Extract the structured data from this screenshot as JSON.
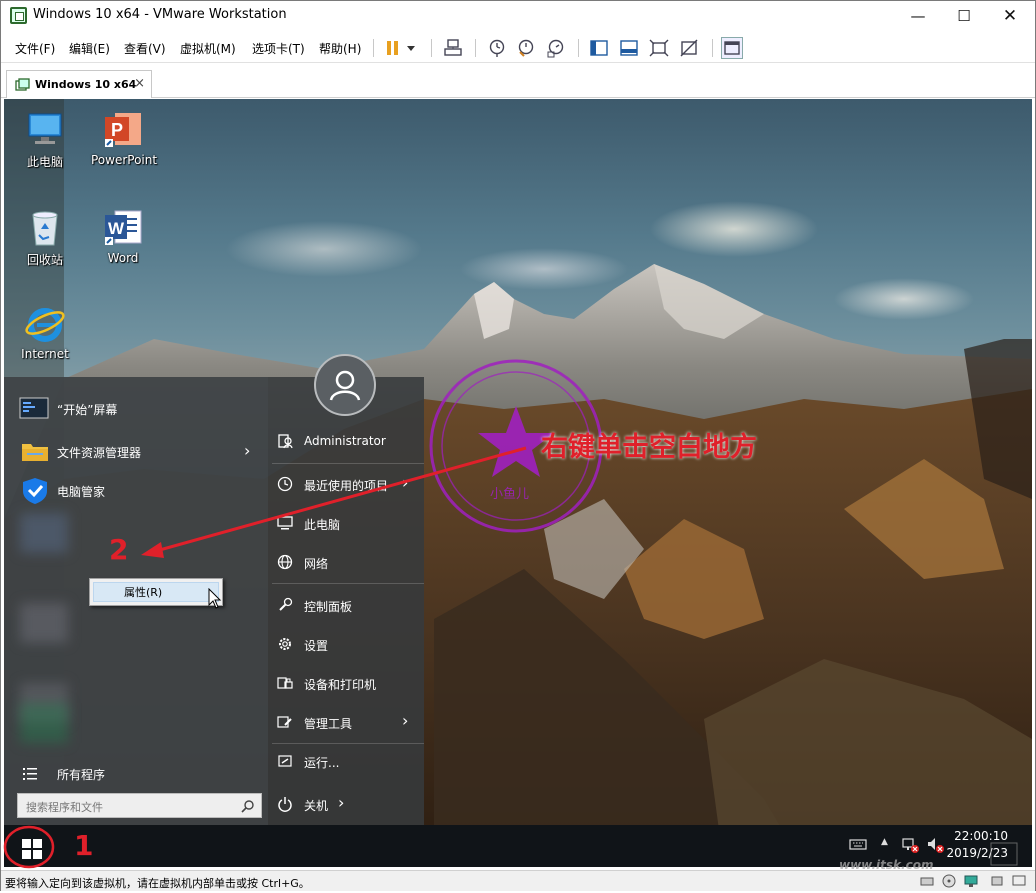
{
  "window": {
    "title": "Windows 10 x64 - VMware Workstation",
    "min_icon": "minimize-icon",
    "max_icon": "maximize-icon",
    "close_icon": "close-icon"
  },
  "menubar": {
    "items": [
      "文件(F)",
      "编辑(E)",
      "查看(V)",
      "虚拟机(M)",
      "选项卡(T)",
      "帮助(H)"
    ]
  },
  "tabs": [
    {
      "label": "Windows 10 x64",
      "close": "×"
    }
  ],
  "desktop": {
    "icons": [
      {
        "label": "此电脑",
        "icon": "this-pc-icon"
      },
      {
        "label": "PowerPoint",
        "icon": "powerpoint-icon"
      },
      {
        "label": "回收站",
        "icon": "recycle-bin-icon"
      },
      {
        "label": "Word",
        "icon": "word-icon"
      },
      {
        "label": "Internet",
        "icon": "internet-explorer-icon"
      }
    ]
  },
  "start_menu": {
    "left_items": [
      {
        "label": "“开始”屏幕",
        "icon": "start-screen-icon"
      },
      {
        "label": "文件资源管理器",
        "icon": "file-explorer-icon",
        "arrow": "›"
      },
      {
        "label": "电脑管家",
        "icon": "pc-manager-icon"
      }
    ],
    "all_programs": "所有程序",
    "search_placeholder": "搜索程序和文件",
    "user": "Administrator",
    "right_items": [
      {
        "label": "最近使用的项目",
        "arrow": "›",
        "icon": "clock-icon"
      },
      {
        "label": "此电脑",
        "icon": "computer-icon"
      },
      {
        "label": "网络",
        "icon": "network-icon"
      },
      {
        "label": "控制面板",
        "icon": "control-panel-icon"
      },
      {
        "label": "设置",
        "icon": "gear-icon"
      },
      {
        "label": "设备和打印机",
        "icon": "printer-icon"
      },
      {
        "label": "管理工具",
        "arrow": "›",
        "icon": "admin-tools-icon"
      },
      {
        "label": "运行...",
        "icon": "run-icon"
      }
    ],
    "shutdown": "关机",
    "shutdown_arrow": "›"
  },
  "context_menu": {
    "items": [
      "属性(R)"
    ]
  },
  "annotations": {
    "step1": "1",
    "step2": "2",
    "instruction": "右键单击空白地方",
    "stamp_text": "小鱼儿"
  },
  "taskbar": {
    "time": "22:00:10",
    "date": "2019/2/23",
    "tray_arrow": "▲"
  },
  "status_bar": {
    "text": "要将输入定向到该虚拟机，请在虚拟机内部单击或按 Ctrl+G。"
  },
  "watermark": "www.itsk.com",
  "colors": {
    "annotation_red": "#e0202a",
    "stamp_purple": "#a020c0",
    "taskbar": "#101418"
  }
}
